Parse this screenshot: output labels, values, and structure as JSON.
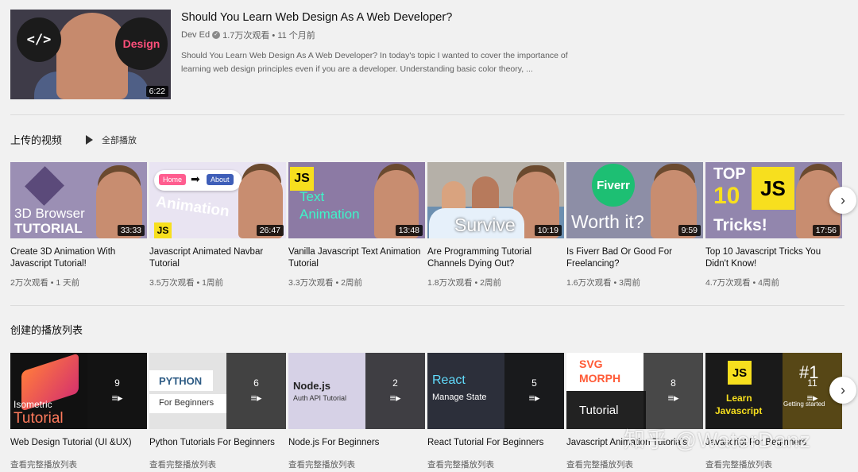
{
  "featured": {
    "title": "Should You Learn Web Design As A Web Developer?",
    "channel": "Dev Ed",
    "stats": "1.7万次观看 • 11 个月前",
    "description": "Should You Learn Web Design As A Web Developer? In today's topic I wanted to cover the importance of learning web design principles even if you are a developer. Understanding basic color theory, ...",
    "duration": "6:22",
    "thumb_code": "</>",
    "thumb_design": "Design"
  },
  "uploads": {
    "title": "上传的视频",
    "play_all": "全部播放",
    "videos": [
      {
        "title": "Create 3D Animation With Javascript Tutorial!",
        "meta": "2万次观看 • 1 天前",
        "duration": "33:33",
        "thumb_text_1": "3D Browser",
        "thumb_text_2": "TUTORIAL"
      },
      {
        "title": "Javascript Animated Navbar Tutorial",
        "meta": "3.5万次观看 • 1周前",
        "duration": "26:47",
        "thumb_text_1": "Home",
        "thumb_text_2": "About",
        "thumb_text_3": "Animation",
        "thumb_text_4": "JS"
      },
      {
        "title": "Vanilla Javascript Text Animation Tutorial",
        "meta": "3.3万次观看 • 2周前",
        "duration": "13:48",
        "thumb_text_1": "JS",
        "thumb_text_2": "Text",
        "thumb_text_3": "Animation"
      },
      {
        "title": "Are Programming Tutorial Channels Dying Out?",
        "meta": "1.8万次观看 • 2周前",
        "duration": "10:19",
        "thumb_text_1": "Survive"
      },
      {
        "title": "Is Fiverr Bad Or Good For Freelancing?",
        "meta": "1.6万次观看 • 3周前",
        "duration": "9:59",
        "thumb_text_1": "Fiverr",
        "thumb_text_2": "Worth it?"
      },
      {
        "title": "Top 10 Javascript Tricks You Didn't Know!",
        "meta": "4.7万次观看 • 4周前",
        "duration": "17:56",
        "thumb_text_1": "TOP",
        "thumb_text_2": "10",
        "thumb_text_3": "JS",
        "thumb_text_4": "Tricks!"
      }
    ]
  },
  "playlists": {
    "title": "创建的播放列表",
    "items": [
      {
        "title": "Web Design Tutorial (UI &UX)",
        "link": "查看完整播放列表",
        "count": "9",
        "thumb_text_1": "Isometric",
        "thumb_text_2": "Tutorial"
      },
      {
        "title": "Python Tutorials For Beginners",
        "link": "查看完整播放列表",
        "count": "6",
        "thumb_text_1": "PYTHON",
        "thumb_text_2": "For Beginners"
      },
      {
        "title": "Node.js For Beginners",
        "link": "查看完整播放列表",
        "count": "2",
        "thumb_text_1": "Node.js",
        "thumb_text_2": "Auth API Tutorial"
      },
      {
        "title": "React Tutorial For Beginners",
        "link": "查看完整播放列表",
        "count": "5",
        "thumb_text_1": "React",
        "thumb_text_2": "Manage State"
      },
      {
        "title": "Javascript Animation Tutorials",
        "link": "查看完整播放列表",
        "count": "8",
        "thumb_text_1": "SVG",
        "thumb_text_2": "MORPH",
        "thumb_text_3": "Tutorial"
      },
      {
        "title": "Javascript For Beginners",
        "link": "查看完整播放列表",
        "count": "11",
        "thumb_text_1": "JS",
        "thumb_text_2": "Learn",
        "thumb_text_3": "Javascript",
        "thumb_text_4": "#1",
        "thumb_text_5": "Getting started"
      }
    ]
  },
  "watermark": "知乎 @WaterDanz",
  "icons": {
    "next": "chevron-right-icon",
    "play": "play-icon",
    "playlist": "playlist-icon",
    "verified": "verified-check-icon"
  }
}
